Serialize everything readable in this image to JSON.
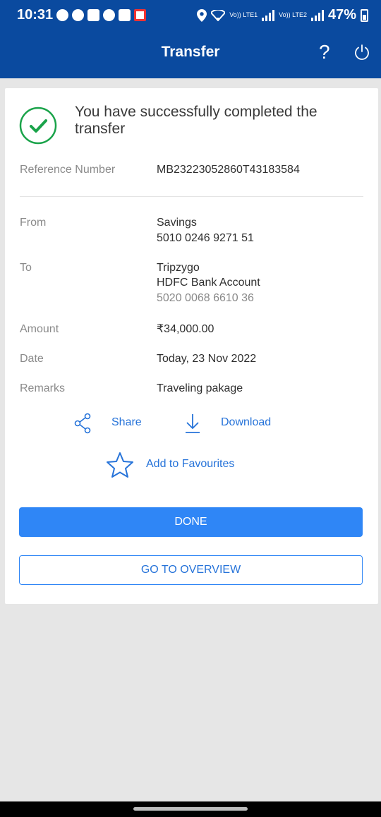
{
  "status_bar": {
    "time": "10:31",
    "network_1": "Vo)) LTE1",
    "network_2": "Vo)) LTE2",
    "battery": "47%"
  },
  "header": {
    "title": "Transfer",
    "help_label": "?",
    "background_color": "#0a4a9f",
    "icons": [
      "help-icon",
      "power-icon"
    ]
  },
  "confirmation": {
    "message": "You have successfully completed the transfer",
    "icon": "check-circle-icon",
    "accent_color": "#1aa34a"
  },
  "details": {
    "reference_label": "Reference Number",
    "reference_value": "MB23223052860T43183584",
    "from_label": "From",
    "from_account_name": "Savings",
    "from_account_number": "5010 0246 9271 51",
    "to_label": "To",
    "to_name": "Tripzygo",
    "to_bank": "HDFC Bank Account",
    "to_account_number": "5020 0068 6610 36",
    "amount_label": "Amount",
    "amount_value": "₹34,000.00",
    "date_label": "Date",
    "date_value": "Today, 23 Nov 2022",
    "remarks_label": "Remarks",
    "remarks_value": "Traveling pakage"
  },
  "actions": {
    "share_label": "Share",
    "download_label": "Download",
    "favourites_label": "Add to Favourites",
    "icons": [
      "share-icon",
      "download-icon",
      "star-icon"
    ]
  },
  "buttons": {
    "done_label": "DONE",
    "overview_label": "GO TO OVERVIEW",
    "primary_color": "#2f86f6"
  }
}
